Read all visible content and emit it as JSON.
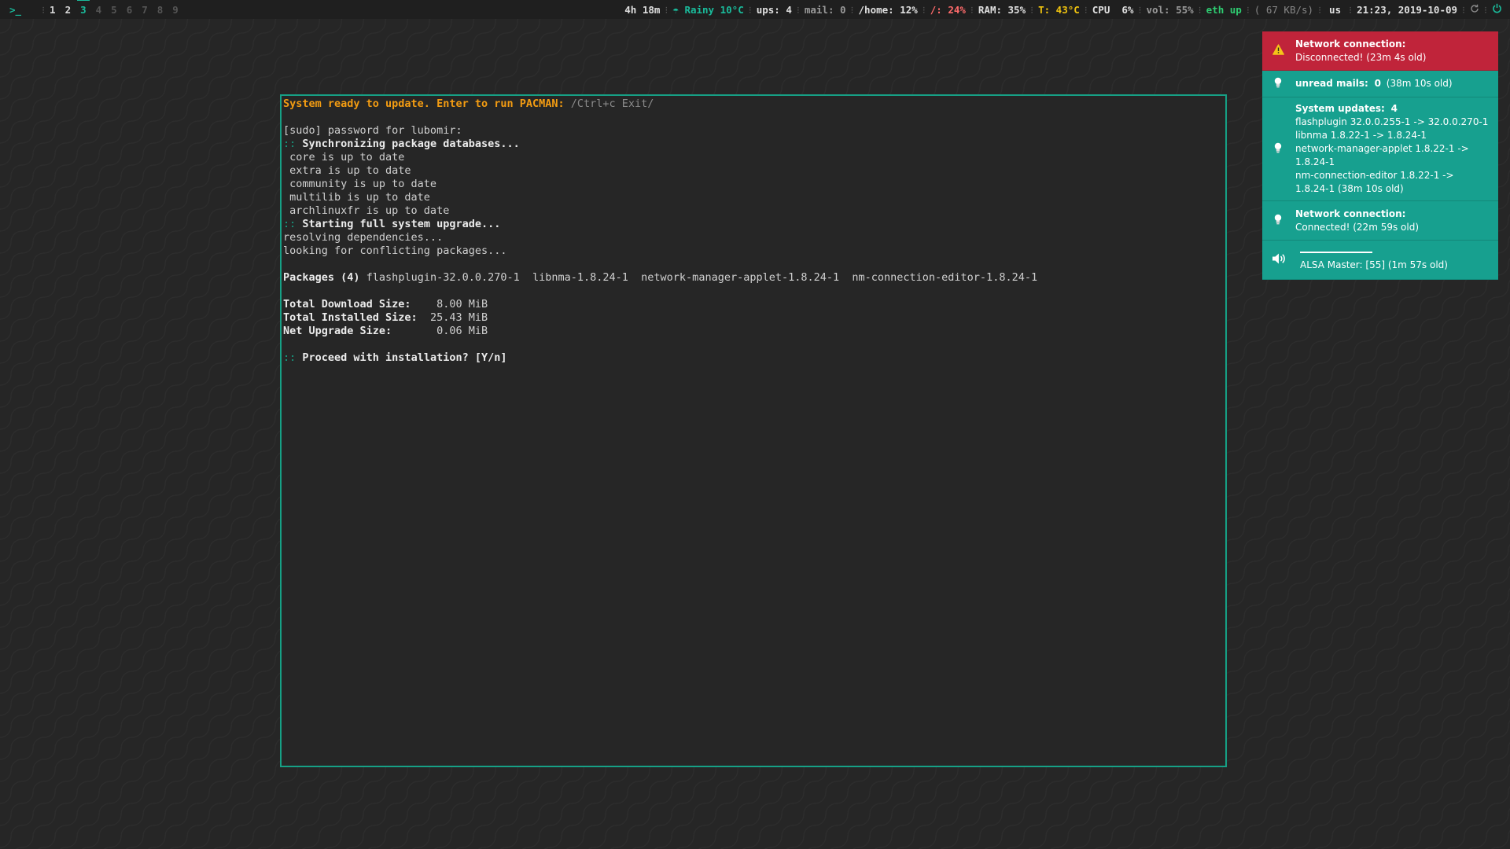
{
  "topbar": {
    "prompt": ">_",
    "workspaces": [
      {
        "label": "1",
        "state": "occupied"
      },
      {
        "label": "2",
        "state": "occupied"
      },
      {
        "label": "3",
        "state": "active"
      },
      {
        "label": "4",
        "state": "empty"
      },
      {
        "label": "5",
        "state": "empty"
      },
      {
        "label": "6",
        "state": "empty"
      },
      {
        "label": "7",
        "state": "empty"
      },
      {
        "label": "8",
        "state": "empty"
      },
      {
        "label": "9",
        "state": "empty"
      }
    ],
    "uptime": "4h 18m",
    "weather": "☂ Rainy 10°C",
    "ups": "ups: 4",
    "mail": "mail: 0",
    "home": "/home: 12%",
    "root": "/: 24%",
    "ram": "RAM: 35%",
    "temp": "T: 43°C",
    "cpu": "CPU  6%",
    "vol": "vol: 55%",
    "eth": "eth up",
    "net_speed": "( 67 KB/s)",
    "kbd": "us",
    "clock": "21:23, 2019-10-09",
    "refresh_icon": "refresh-icon",
    "power_icon": "power-icon"
  },
  "terminal": {
    "header_prompt": "System ready to update. Enter to run PACMAN:",
    "header_hint": " /Ctrl+c Exit/",
    "sudo": "[sudo] password for lubomir:",
    "marker": "::",
    "sync": " Synchronizing package databases...",
    "repos": [
      " core is up to date",
      " extra is up to date",
      " community is up to date",
      " multilib is up to date",
      " archlinuxfr is up to date"
    ],
    "upgrade": " Starting full system upgrade...",
    "resolving": "resolving dependencies...",
    "conflicts": "looking for conflicting packages...",
    "packages_label": "Packages (4)",
    "packages_list": " flashplugin-32.0.0.270-1  libnma-1.8.24-1  network-manager-applet-1.8.24-1  nm-connection-editor-1.8.24-1",
    "download_label": "Total Download Size:",
    "download_value": "    8.00 MiB",
    "installed_label": "Total Installed Size:",
    "installed_value": "  25.43 MiB",
    "net_label": "Net Upgrade Size:",
    "net_value": "       0.06 MiB",
    "proceed": " Proceed with installation? [Y/n]"
  },
  "notifications": [
    {
      "icon": "warning-icon",
      "color": "#c0243a",
      "title": "Network connection:",
      "body": "Disconnected! (23m 4s old)"
    },
    {
      "icon": "bulb-icon",
      "color": "#17a08f",
      "title": "unread mails:",
      "title_value": "0",
      "body": "(38m 10s old)"
    },
    {
      "icon": "bulb-icon",
      "color": "#17a08f",
      "title": "System updates:",
      "title_value": "4",
      "body": "flashplugin 32.0.0.255-1 -> 32.0.0.270-1\nlibnma 1.8.22-1 -> 1.8.24-1\nnetwork-manager-applet 1.8.22-1 ->\n1.8.24-1\nnm-connection-editor 1.8.22-1 ->\n1.8.24-1 (38m 10s old)"
    },
    {
      "icon": "bulb-icon",
      "color": "#17a08f",
      "title": "Network connection:",
      "body": "Connected! (22m 59s old)"
    },
    {
      "icon": "speaker-icon",
      "color": "#17a08f",
      "volume": 0.55,
      "body": "ALSA Master:  [55] (1m 57s old)"
    }
  ]
}
